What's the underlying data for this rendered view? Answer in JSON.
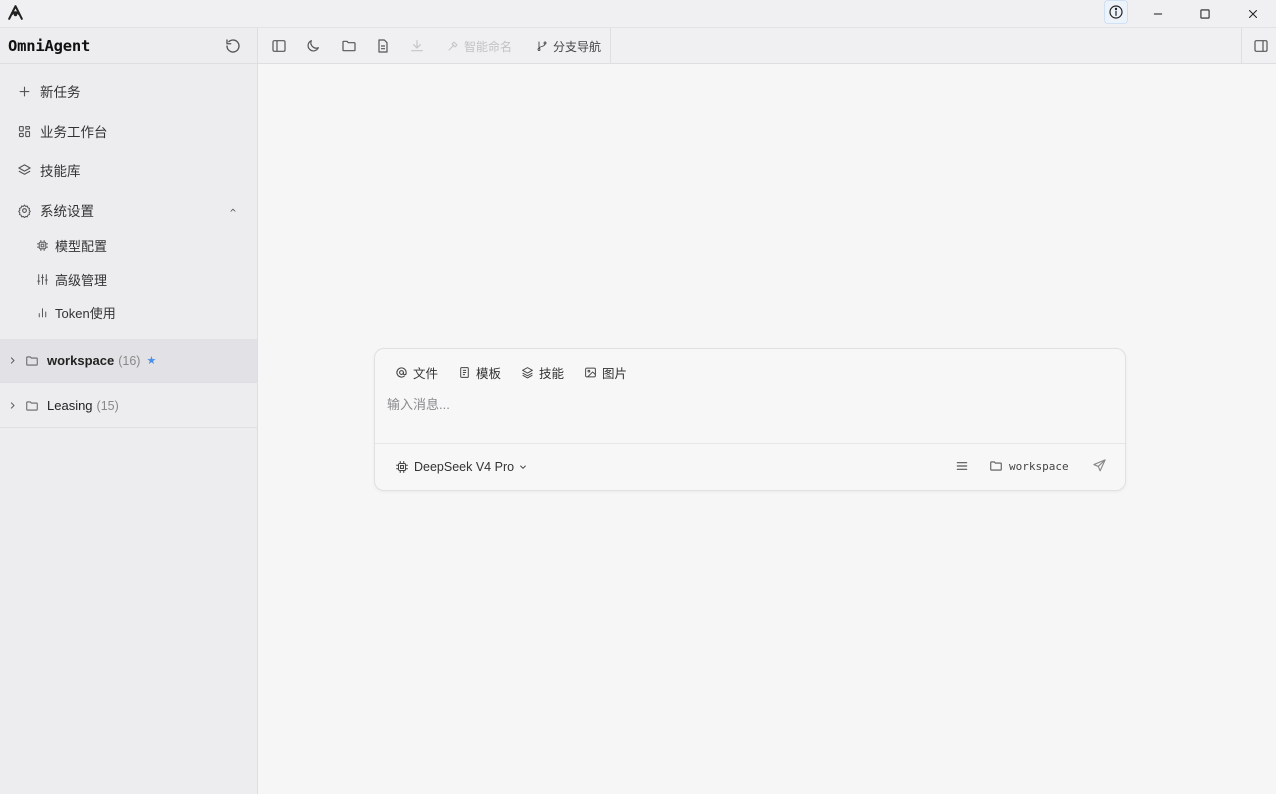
{
  "app": {
    "name": "OmniAgent"
  },
  "sidebar": {
    "nav": [
      {
        "label": "新任务",
        "icon": "plus-icon"
      },
      {
        "label": "业务工作台",
        "icon": "dashboard-grid-icon"
      },
      {
        "label": "技能库",
        "icon": "layers-icon"
      },
      {
        "label": "系统设置",
        "icon": "gear-icon",
        "expanded": true
      }
    ],
    "settings_children": [
      {
        "label": "模型配置",
        "icon": "cpu-chip-icon"
      },
      {
        "label": "高级管理",
        "icon": "sliders-icon"
      },
      {
        "label": "Token使用",
        "icon": "bar-chart-icon"
      }
    ],
    "folders": [
      {
        "name": "workspace",
        "count": "(16)",
        "starred": "★",
        "active": true
      },
      {
        "name": "Leasing",
        "count": "(15)",
        "starred": "",
        "active": false
      }
    ]
  },
  "toolbar": {
    "smart_name_label": "智能命名",
    "branch_nav_label": "分支导航"
  },
  "composer": {
    "chips": [
      {
        "label": "文件",
        "icon": "at-icon"
      },
      {
        "label": "模板",
        "icon": "document-icon"
      },
      {
        "label": "技能",
        "icon": "layers-icon"
      },
      {
        "label": "图片",
        "icon": "image-icon"
      }
    ],
    "placeholder": "输入消息...",
    "model": "DeepSeek V4 Pro",
    "workspace": "workspace"
  },
  "colors": {
    "accent": "#4a8fe7",
    "sidebar_bg": "#ededf0",
    "main_bg": "#f6f6f6"
  }
}
